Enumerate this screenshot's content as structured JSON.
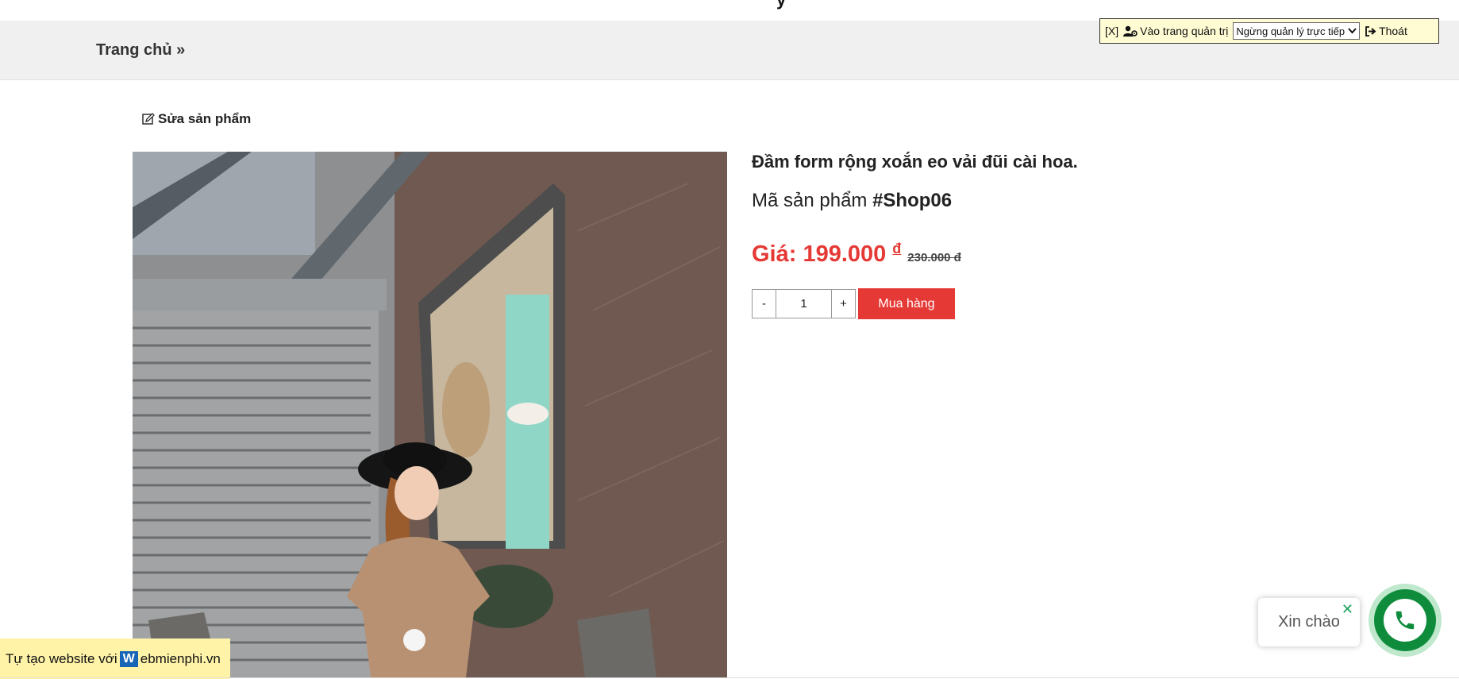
{
  "top": {
    "glyph": "y"
  },
  "breadcrumb": {
    "home": "Trang chủ »"
  },
  "admin_bar": {
    "close": "[X]",
    "admin_link": "Vào trang quản trị",
    "mode_select": "Ngừng quản lý trực tiếp",
    "logout": "Thoát"
  },
  "edit": {
    "label": "Sửa sản phẩm"
  },
  "product": {
    "title": "Đầm form rộng xoắn eo vải đũi cài hoa.",
    "sku_label": "Mã sản phẩm",
    "sku_value": "#Shop06",
    "price": "Giá: 199.000",
    "currency": "đ",
    "old_price": "230.000 đ",
    "qty_minus": "-",
    "qty_value": "1",
    "qty_plus": "+",
    "buy_label": "Mua hàng"
  },
  "footer": {
    "prefix": "Tự tạo website với",
    "logo_letter": "W",
    "site": "ebmienphi.vn"
  },
  "chat": {
    "greeting": "Xin chào",
    "close": "✕"
  },
  "colors": {
    "accent_red": "#e53935",
    "call_green": "#0e8c3c",
    "admin_bg": "#fffbd3",
    "footer_bg": "#fff3a8"
  }
}
